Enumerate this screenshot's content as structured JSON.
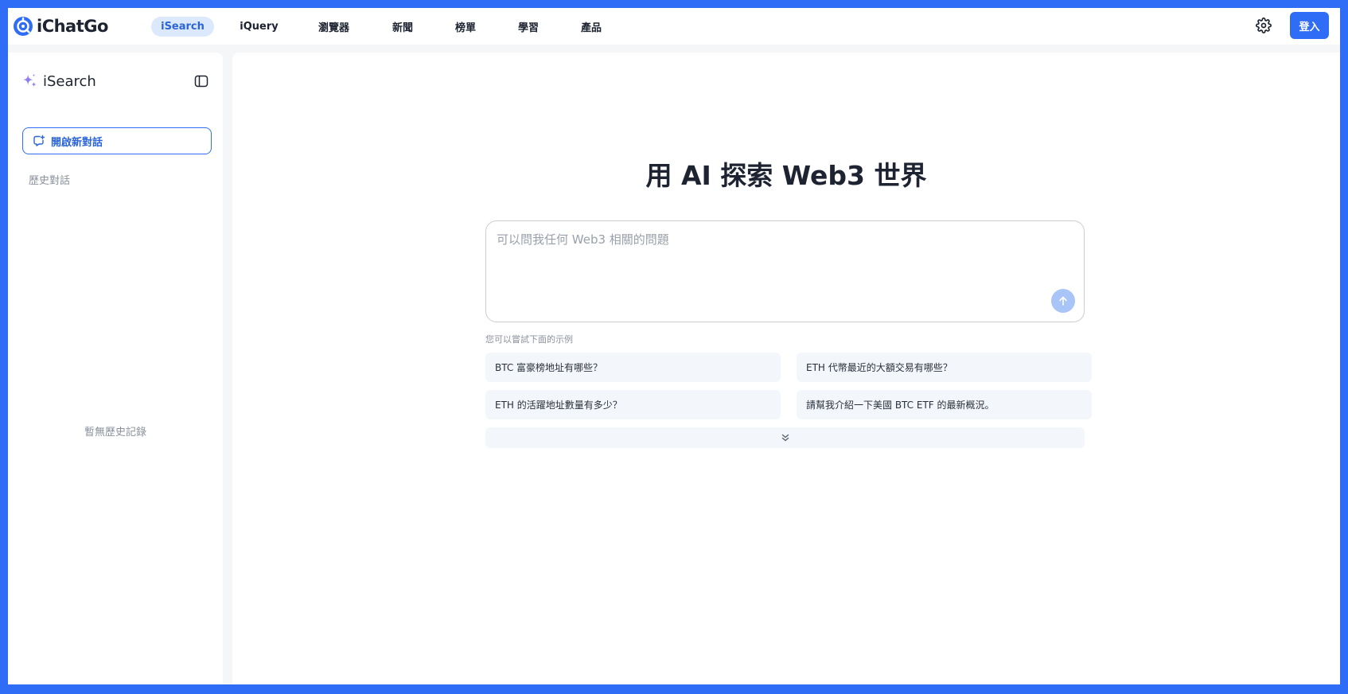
{
  "brand": {
    "name": "iChatGo",
    "logo_icon": "ichatgo-logo-icon",
    "accent_color": "#2f6df6"
  },
  "nav": {
    "items": [
      {
        "label": "iSearch",
        "active": true
      },
      {
        "label": "iQuery",
        "active": false
      },
      {
        "label": "瀏覽器",
        "active": false
      },
      {
        "label": "新聞",
        "active": false
      },
      {
        "label": "榜單",
        "active": false
      },
      {
        "label": "學習",
        "active": false
      },
      {
        "label": "產品",
        "active": false
      }
    ]
  },
  "topbar": {
    "settings_icon": "gear-icon",
    "login_label": "登入"
  },
  "sidebar": {
    "title": "iSearch",
    "title_icon": "sparkle-icon",
    "toggle_icon": "sidebar-toggle-icon",
    "new_chat_label": "開啟新對話",
    "new_chat_icon": "chat-plus-icon",
    "history_title": "歷史對話",
    "history_empty": "暫無歷史記錄"
  },
  "main": {
    "headline": "用 AI 探索 Web3 世界",
    "search": {
      "placeholder": "可以問我任何 Web3 相關的問題",
      "value": "",
      "send_icon": "arrow-up-icon"
    },
    "hint": "您可以嘗試下面的示例",
    "examples": [
      "BTC 富豪榜地址有哪些？",
      "ETH 代幣最近的大額交易有哪些？",
      "ETH 的活躍地址數量有多少？",
      "請幫我介紹一下美國 BTC ETF 的最新概況。"
    ],
    "more_icon": "chevrons-down-icon"
  }
}
